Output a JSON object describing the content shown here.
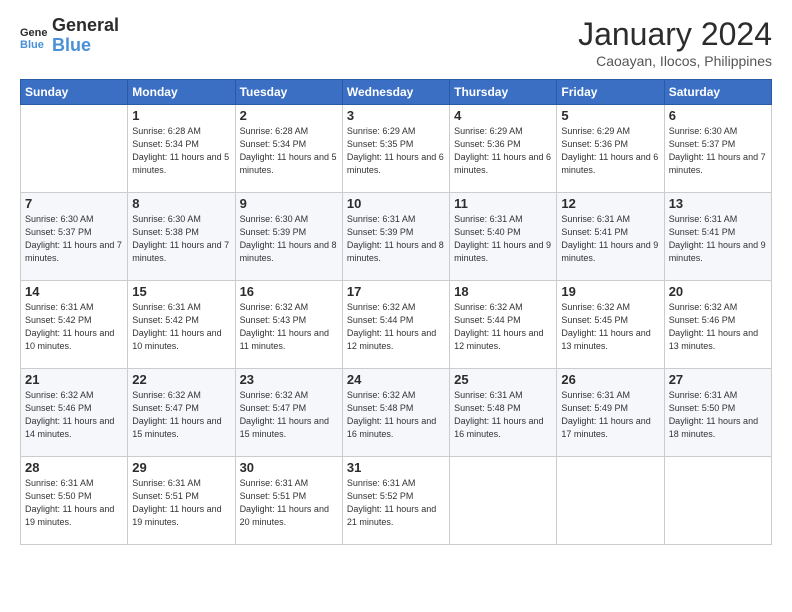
{
  "logo": {
    "line1": "General",
    "line2": "Blue"
  },
  "header": {
    "month": "January 2024",
    "location": "Caoayan, Ilocos, Philippines"
  },
  "weekdays": [
    "Sunday",
    "Monday",
    "Tuesday",
    "Wednesday",
    "Thursday",
    "Friday",
    "Saturday"
  ],
  "weeks": [
    [
      {
        "day": "",
        "sunrise": "",
        "sunset": "",
        "daylight": ""
      },
      {
        "day": "1",
        "sunrise": "6:28 AM",
        "sunset": "5:34 PM",
        "daylight": "11 hours and 5 minutes."
      },
      {
        "day": "2",
        "sunrise": "6:28 AM",
        "sunset": "5:34 PM",
        "daylight": "11 hours and 5 minutes."
      },
      {
        "day": "3",
        "sunrise": "6:29 AM",
        "sunset": "5:35 PM",
        "daylight": "11 hours and 6 minutes."
      },
      {
        "day": "4",
        "sunrise": "6:29 AM",
        "sunset": "5:36 PM",
        "daylight": "11 hours and 6 minutes."
      },
      {
        "day": "5",
        "sunrise": "6:29 AM",
        "sunset": "5:36 PM",
        "daylight": "11 hours and 6 minutes."
      },
      {
        "day": "6",
        "sunrise": "6:30 AM",
        "sunset": "5:37 PM",
        "daylight": "11 hours and 7 minutes."
      }
    ],
    [
      {
        "day": "7",
        "sunrise": "6:30 AM",
        "sunset": "5:37 PM",
        "daylight": "11 hours and 7 minutes."
      },
      {
        "day": "8",
        "sunrise": "6:30 AM",
        "sunset": "5:38 PM",
        "daylight": "11 hours and 7 minutes."
      },
      {
        "day": "9",
        "sunrise": "6:30 AM",
        "sunset": "5:39 PM",
        "daylight": "11 hours and 8 minutes."
      },
      {
        "day": "10",
        "sunrise": "6:31 AM",
        "sunset": "5:39 PM",
        "daylight": "11 hours and 8 minutes."
      },
      {
        "day": "11",
        "sunrise": "6:31 AM",
        "sunset": "5:40 PM",
        "daylight": "11 hours and 9 minutes."
      },
      {
        "day": "12",
        "sunrise": "6:31 AM",
        "sunset": "5:41 PM",
        "daylight": "11 hours and 9 minutes."
      },
      {
        "day": "13",
        "sunrise": "6:31 AM",
        "sunset": "5:41 PM",
        "daylight": "11 hours and 9 minutes."
      }
    ],
    [
      {
        "day": "14",
        "sunrise": "6:31 AM",
        "sunset": "5:42 PM",
        "daylight": "11 hours and 10 minutes."
      },
      {
        "day": "15",
        "sunrise": "6:31 AM",
        "sunset": "5:42 PM",
        "daylight": "11 hours and 10 minutes."
      },
      {
        "day": "16",
        "sunrise": "6:32 AM",
        "sunset": "5:43 PM",
        "daylight": "11 hours and 11 minutes."
      },
      {
        "day": "17",
        "sunrise": "6:32 AM",
        "sunset": "5:44 PM",
        "daylight": "11 hours and 12 minutes."
      },
      {
        "day": "18",
        "sunrise": "6:32 AM",
        "sunset": "5:44 PM",
        "daylight": "11 hours and 12 minutes."
      },
      {
        "day": "19",
        "sunrise": "6:32 AM",
        "sunset": "5:45 PM",
        "daylight": "11 hours and 13 minutes."
      },
      {
        "day": "20",
        "sunrise": "6:32 AM",
        "sunset": "5:46 PM",
        "daylight": "11 hours and 13 minutes."
      }
    ],
    [
      {
        "day": "21",
        "sunrise": "6:32 AM",
        "sunset": "5:46 PM",
        "daylight": "11 hours and 14 minutes."
      },
      {
        "day": "22",
        "sunrise": "6:32 AM",
        "sunset": "5:47 PM",
        "daylight": "11 hours and 15 minutes."
      },
      {
        "day": "23",
        "sunrise": "6:32 AM",
        "sunset": "5:47 PM",
        "daylight": "11 hours and 15 minutes."
      },
      {
        "day": "24",
        "sunrise": "6:32 AM",
        "sunset": "5:48 PM",
        "daylight": "11 hours and 16 minutes."
      },
      {
        "day": "25",
        "sunrise": "6:31 AM",
        "sunset": "5:48 PM",
        "daylight": "11 hours and 16 minutes."
      },
      {
        "day": "26",
        "sunrise": "6:31 AM",
        "sunset": "5:49 PM",
        "daylight": "11 hours and 17 minutes."
      },
      {
        "day": "27",
        "sunrise": "6:31 AM",
        "sunset": "5:50 PM",
        "daylight": "11 hours and 18 minutes."
      }
    ],
    [
      {
        "day": "28",
        "sunrise": "6:31 AM",
        "sunset": "5:50 PM",
        "daylight": "11 hours and 19 minutes."
      },
      {
        "day": "29",
        "sunrise": "6:31 AM",
        "sunset": "5:51 PM",
        "daylight": "11 hours and 19 minutes."
      },
      {
        "day": "30",
        "sunrise": "6:31 AM",
        "sunset": "5:51 PM",
        "daylight": "11 hours and 20 minutes."
      },
      {
        "day": "31",
        "sunrise": "6:31 AM",
        "sunset": "5:52 PM",
        "daylight": "11 hours and 21 minutes."
      },
      {
        "day": "",
        "sunrise": "",
        "sunset": "",
        "daylight": ""
      },
      {
        "day": "",
        "sunrise": "",
        "sunset": "",
        "daylight": ""
      },
      {
        "day": "",
        "sunrise": "",
        "sunset": "",
        "daylight": ""
      }
    ]
  ]
}
